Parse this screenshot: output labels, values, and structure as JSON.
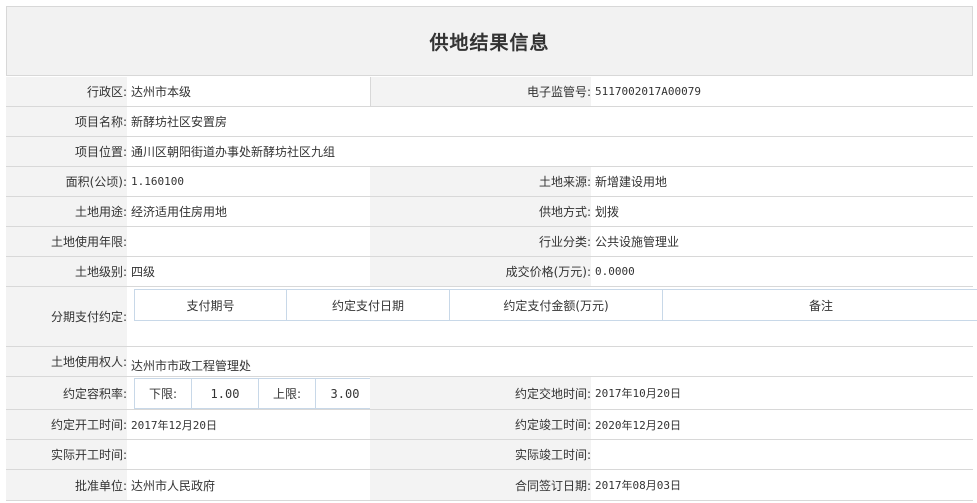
{
  "title": "供地结果信息",
  "fields": {
    "district_label": "行政区:",
    "district": "达州市本级",
    "supervision_label": "电子监管号:",
    "supervision_no": "5117002017A00079",
    "project_name_label": "项目名称:",
    "project_name": "新酵坊社区安置房",
    "project_location_label": "项目位置:",
    "project_location": "通川区朝阳街道办事处新酵坊社区九组",
    "area_label": "面积(公顷):",
    "area": "1.160100",
    "land_source_label": "土地来源:",
    "land_source": "新增建设用地",
    "land_use_label": "土地用途:",
    "land_use": "经济适用住房用地",
    "supply_method_label": "供地方式:",
    "supply_method": "划拨",
    "use_years_label": "土地使用年限:",
    "use_years": "",
    "industry_label": "行业分类:",
    "industry": "公共设施管理业",
    "land_grade_label": "土地级别:",
    "land_grade": "四级",
    "price_label": "成交价格(万元):",
    "price": "0.0000",
    "installment_label": "分期支付约定:",
    "installment_headers": [
      "支付期号",
      "约定支付日期",
      "约定支付金额(万元)",
      "备注"
    ],
    "user_label": "土地使用权人:",
    "user": "达州市市政工程管理处",
    "far_label": "约定容积率:",
    "far_lower_label": "下限:",
    "far_lower": "1.00",
    "far_upper_label": "上限:",
    "far_upper": "3.00",
    "delivery_label": "约定交地时间:",
    "delivery": "2017年10月20日",
    "start_label": "约定开工时间:",
    "start": "2017年12月20日",
    "completion_label": "约定竣工时间:",
    "completion": "2020年12月20日",
    "actual_start_label": "实际开工时间:",
    "actual_start": "",
    "actual_completion_label": "实际竣工时间:",
    "actual_completion": "",
    "approval_label": "批准单位:",
    "approval": "达州市人民政府",
    "contract_label": "合同签订日期:",
    "contract": "2017年08月03日"
  }
}
